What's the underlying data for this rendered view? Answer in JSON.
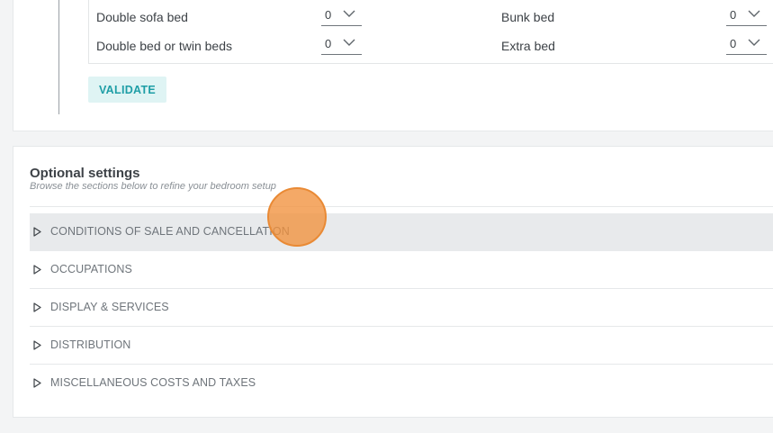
{
  "beds": {
    "left": [
      {
        "label": "Double sofa bed",
        "value": "0"
      },
      {
        "label": "Double bed or twin beds",
        "value": "0"
      }
    ],
    "right": [
      {
        "label": "Bunk bed",
        "value": "0"
      },
      {
        "label": "Extra bed",
        "value": "0"
      }
    ]
  },
  "validate_label": "VALIDATE",
  "optional": {
    "title": "Optional settings",
    "subtitle": "Browse the sections below to refine your bedroom setup",
    "sections": [
      {
        "label": "CONDITIONS OF SALE AND CANCELLATION"
      },
      {
        "label": "OCCUPATIONS"
      },
      {
        "label": "DISPLAY & SERVICES"
      },
      {
        "label": "DISTRIBUTION"
      },
      {
        "label": "MISCELLANEOUS COSTS AND TAXES"
      }
    ]
  },
  "icons": {
    "select": "chevron-down-icon",
    "section": "triangle-right-icon"
  },
  "colors": {
    "accent": "#1e9ea6",
    "button_bg": "#dff4f4",
    "active_row": "#e8eaec",
    "cursor": "#f1913c"
  }
}
